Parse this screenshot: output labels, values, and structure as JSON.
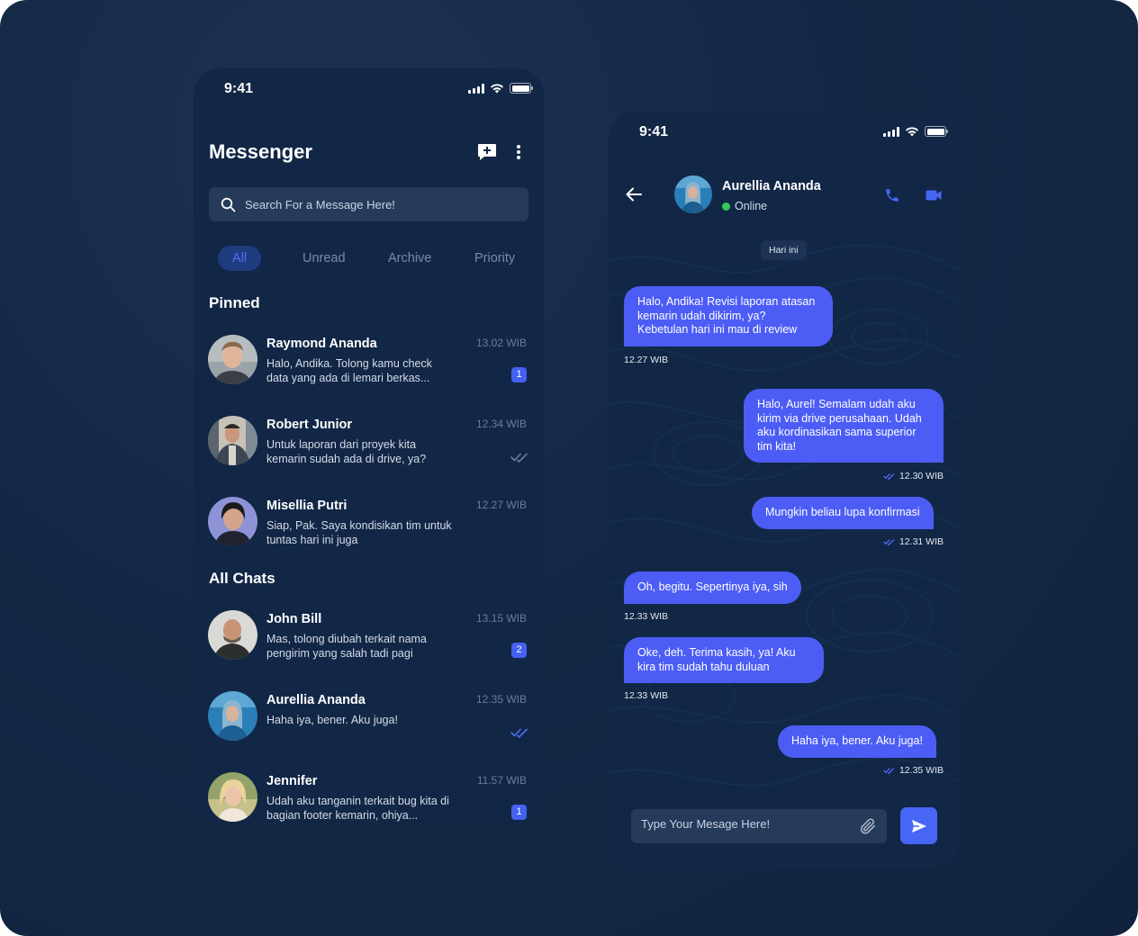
{
  "list": {
    "status_time": "9:41",
    "title": "Messenger",
    "search_placeholder": "Search For a Message Here!",
    "tabs": [
      {
        "label": "All",
        "active": true
      },
      {
        "label": "Unread",
        "active": false
      },
      {
        "label": "Archive",
        "active": false
      },
      {
        "label": "Priority",
        "active": false
      }
    ],
    "pinned_title": "Pinned",
    "pinned": [
      {
        "name": "Raymond Ananda",
        "preview": "Halo, Andika. Tolong kamu check data yang ada di lemari berkas...",
        "time": "13.02 WIB",
        "badge": "1"
      },
      {
        "name": "Robert Junior",
        "preview": "Untuk laporan dari proyek kita kemarin sudah ada di drive, ya?",
        "time": "12.34 WIB",
        "indicator": "read-check-icon"
      },
      {
        "name": "Misellia Putri",
        "preview": "Siap, Pak. Saya kondisikan tim untuk tuntas hari ini juga",
        "time": "12.27 WIB"
      }
    ],
    "all_title": "All Chats",
    "chats": [
      {
        "name": "John Bill",
        "preview": "Mas, tolong diubah terkait nama pengirim yang salah tadi pagi",
        "time": "13.15 WIB",
        "badge": "2"
      },
      {
        "name": "Aurellia Ananda",
        "preview": "Haha iya, bener. Aku juga!",
        "time": "12.35 WIB",
        "indicator": "read-check-icon"
      },
      {
        "name": "Jennifer",
        "preview": "Udah aku tanganin terkait bug kita di bagian footer kemarin, ohiya...",
        "time": "11.57 WIB",
        "badge": "1"
      }
    ]
  },
  "chat": {
    "status_time": "9:41",
    "contact_name": "Aurellia Ananda",
    "contact_status": "Online",
    "day_label": "Hari ini",
    "messages": [
      {
        "dir": "in",
        "text": "Halo, Andika! Revisi laporan atasan kemarin udah dikirim, ya? Kebetulan hari ini mau di review",
        "time": "12.27 WIB"
      },
      {
        "dir": "out",
        "text": "Halo, Aurel! Semalam udah aku kirim via drive perusahaan. Udah aku kordinasikan sama superior tim kita!",
        "time": "12.30 WIB"
      },
      {
        "dir": "out",
        "text": "Mungkin beliau lupa konfirmasi",
        "time": "12.31 WIB"
      },
      {
        "dir": "in",
        "text": "Oh, begitu. Sepertinya iya, sih",
        "time": "12.33 WIB"
      },
      {
        "dir": "in",
        "text": "Oke, deh. Terima kasih, ya! Aku kira tim sudah tahu duluan",
        "time": "12.33 WIB"
      },
      {
        "dir": "out",
        "text": "Haha iya, bener. Aku juga!",
        "time": "12.35 WIB"
      }
    ],
    "composer_placeholder": "Type Your Mesage Here!"
  },
  "colors": {
    "background": "#142845",
    "panel": "#122746",
    "accent": "#4c5df5",
    "input": "#263a5a",
    "online": "#34c759"
  }
}
